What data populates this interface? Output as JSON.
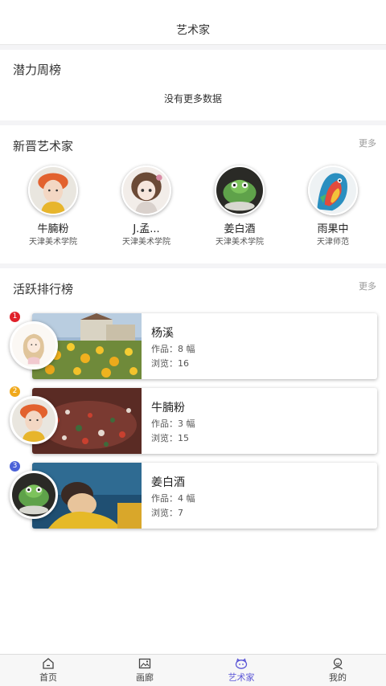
{
  "header": {
    "title": "艺术家"
  },
  "weekly": {
    "title": "潜力周榜",
    "empty_text": "没有更多数据"
  },
  "newcomers": {
    "title": "新晋艺术家",
    "more": "更多",
    "items": [
      {
        "name": "牛腩粉",
        "school": "天津美术学院"
      },
      {
        "name": "J.孟...",
        "school": "天津美术学院"
      },
      {
        "name": "姜白酒",
        "school": "天津美术学院"
      },
      {
        "name": "雨果中",
        "school": "天津师范"
      }
    ]
  },
  "active": {
    "title": "活跃排行榜",
    "more": "更多",
    "items": [
      {
        "rank": "1",
        "name": "杨溪",
        "works": "作品：8 幅",
        "views": "浏览：16",
        "badge_color": "#e0202a"
      },
      {
        "rank": "2",
        "name": "牛腩粉",
        "works": "作品：3 幅",
        "views": "浏览：15",
        "badge_color": "#f0a91c"
      },
      {
        "rank": "3",
        "name": "姜白酒",
        "works": "作品：4 幅",
        "views": "浏览：7",
        "badge_color": "#4b62d8"
      }
    ]
  },
  "nav": {
    "items": [
      {
        "label": "首页",
        "icon": "home-icon"
      },
      {
        "label": "画廊",
        "icon": "gallery-icon"
      },
      {
        "label": "艺术家",
        "icon": "artist-icon"
      },
      {
        "label": "我的",
        "icon": "profile-icon"
      }
    ],
    "active_color": "#5b56d6"
  }
}
